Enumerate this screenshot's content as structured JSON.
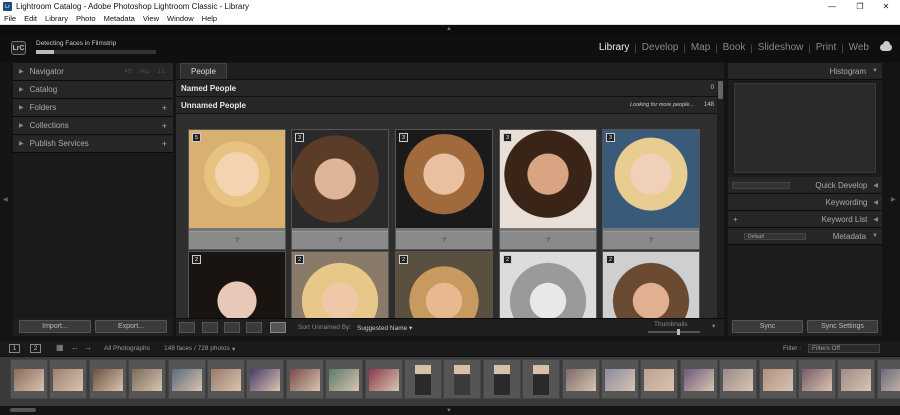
{
  "window": {
    "title": "Lightroom Catalog - Adobe Photoshop Lightroom Classic - Library",
    "logo": "Lr"
  },
  "menu": [
    "File",
    "Edit",
    "Library",
    "Photo",
    "Metadata",
    "View",
    "Window",
    "Help"
  ],
  "header": {
    "badge": "LrC",
    "progress_label": "Detecting Faces in Filmstrip",
    "progress": 0.15,
    "modules": [
      "Library",
      "Develop",
      "Map",
      "Book",
      "Slideshow",
      "Print",
      "Web"
    ],
    "active_module": "Library"
  },
  "left_panel": {
    "navigator": {
      "label": "Navigator",
      "options": [
        "FIT",
        "FILL",
        "1:1"
      ]
    },
    "items": [
      {
        "label": "Catalog",
        "has_plus": false
      },
      {
        "label": "Folders",
        "has_plus": true
      },
      {
        "label": "Collections",
        "has_plus": true
      },
      {
        "label": "Publish Services",
        "has_plus": true
      }
    ],
    "import_label": "Import...",
    "export_label": "Export..."
  },
  "center": {
    "tab": "People",
    "named_people": {
      "label": "Named People",
      "count": "0"
    },
    "unnamed_people": {
      "label": "Unnamed People",
      "hint": "Looking for more people...",
      "count": "148"
    },
    "faces": [
      {
        "count": "5",
        "name": "?"
      },
      {
        "count": "3",
        "name": "?"
      },
      {
        "count": "3",
        "name": "?"
      },
      {
        "count": "3",
        "name": "?"
      },
      {
        "count": "3",
        "name": "?"
      },
      {
        "count": "2",
        "name": "?"
      },
      {
        "count": "2",
        "name": "?"
      },
      {
        "count": "2",
        "name": "?"
      },
      {
        "count": "2",
        "name": "?"
      },
      {
        "count": "2",
        "name": "?"
      }
    ],
    "toolbar": {
      "sort_label": "Sort Unnamed By:",
      "sort_value": "Suggested Name",
      "thumbnails_label": "Thumbnails",
      "thumbnail_size": 0.55
    }
  },
  "right_panel": {
    "histogram": "Histogram",
    "quick_develop": "Quick Develop",
    "keywording": "Keywording",
    "keyword_list": "Keyword List",
    "metadata": "Metadata",
    "metadata_preset": "Default",
    "sync_label": "Sync",
    "sync_settings_label": "Sync Settings"
  },
  "filmstrip": {
    "pages": [
      "1",
      "2"
    ],
    "source": "All Photographs",
    "counts": "148 faces / 728 photos",
    "filter_label": "Filter :",
    "filter_value": "Filters Off"
  }
}
